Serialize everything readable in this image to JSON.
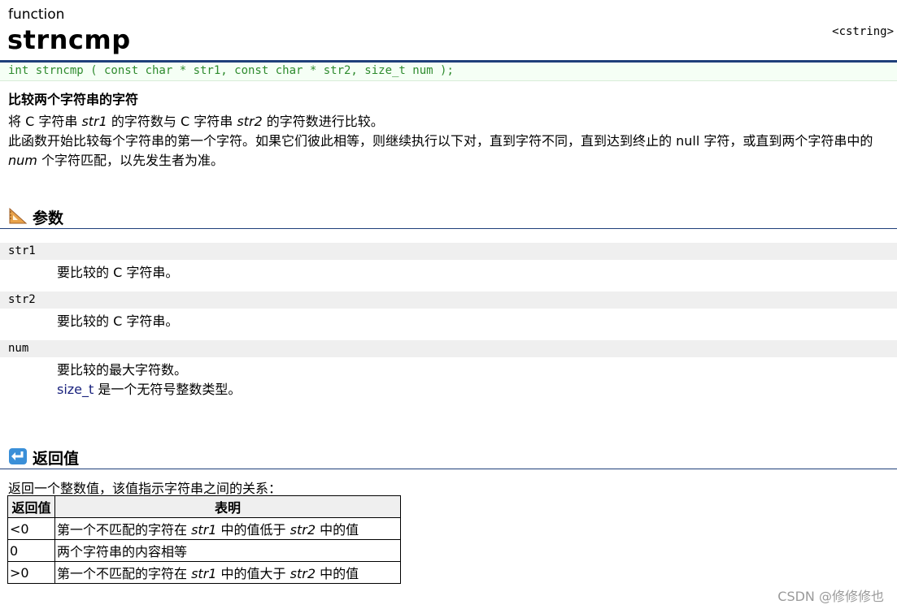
{
  "page": {
    "kind": "function",
    "title": "strncmp",
    "header": "<cstring>",
    "prototype": "int strncmp ( const char * str1, const char * str2, size_t num );",
    "summary": "比较两个字符串的字符"
  },
  "description": {
    "line1": {
      "p1": "将 C 字符串 ",
      "v1": "str1",
      "p2": " 的字符数与 C 字符串 ",
      "v2": "str2",
      "p3": " 的字符数进行比较。"
    },
    "line2": {
      "p1": "此函数开始比较每个字符串的第一个字符。如果它们彼此相等，则继续执行以下对，直到字符不同，直到达到终止的 null 字符，或直到两个字符串中的 ",
      "v1": "num",
      "p2": " 个字符匹配，以先发生者为准。"
    }
  },
  "params_section": {
    "title": "参数",
    "icon": "triangle-ruler-icon"
  },
  "params": [
    {
      "name": "str1",
      "desc": "要比较的 C 字符串。"
    },
    {
      "name": "str2",
      "desc": "要比较的 C 字符串。"
    },
    {
      "name": "num",
      "desc": "要比较的最大字符数。",
      "note_link": "size_t",
      "note_text": " 是一个无符号整数类型。"
    }
  ],
  "return_section": {
    "title": "返回值",
    "icon": "return-arrow-icon",
    "intro": "返回一个整数值，该值指示字符串之间的关系："
  },
  "return_table": {
    "headers": [
      "返回值",
      "表明"
    ],
    "rows": [
      {
        "value": "<0",
        "p1": "第一个不匹配的字符在 ",
        "v1": "str1",
        "p2": " 中的值低于 ",
        "v2": "str2",
        "p3": " 中的值"
      },
      {
        "value": "0",
        "p1": "两个字符串的内容相等",
        "v1": "",
        "p2": "",
        "v2": "",
        "p3": ""
      },
      {
        "value": ">0",
        "p1": "第一个不匹配的字符在 ",
        "v1": "str1",
        "p2": " 中的值大于 ",
        "v2": "str2",
        "p3": " 中的值"
      }
    ]
  },
  "watermark": "CSDN @修修修也"
}
